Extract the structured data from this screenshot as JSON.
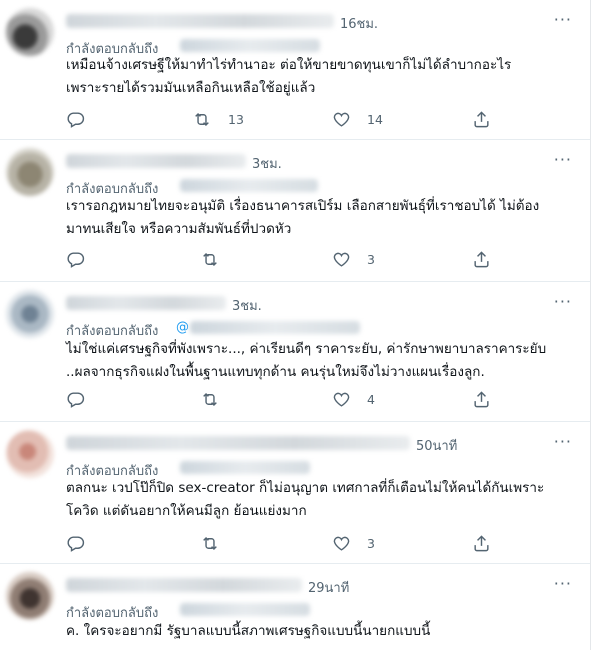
{
  "tweets": [
    {
      "time": "16ชม.",
      "reply_label": "กำลังตอบกลับถึง",
      "lines": [
        "เหมือนจ้างเศรษฐีให้มาทำไร่ทำนาอะ ต่อให้ขายขาดทุนเขาก็ไม่ได้ลำบากอะไร",
        "เพราะรายได้รวมมันเหลือกินเหลือใช้อยู่แล้ว"
      ],
      "retweets": "13",
      "likes": "14"
    },
    {
      "time": "3ชม.",
      "reply_label": "กำลังตอบกลับถึง",
      "lines": [
        "เรารอกฎหมายไทยจะอนุมัติ เรื่องธนาคารสเปิร์ม  เลือกสายพันธุ์ที่เราชอบได้ ไม่ต้อง",
        "มาทนเสียใจ หรือความสัมพันธ์ที่ปวดหัว"
      ],
      "retweets": "",
      "likes": "3"
    },
    {
      "time": "3ชม.",
      "reply_label": "กำลังตอบกลับถึง",
      "reply_at": "@",
      "lines": [
        "ไม่ใช่แค่เศรษฐกิจที่พังเพราะ..., ค่าเรียนดีๆ ราคาระยับ, ค่ารักษาพยาบาลราคาระยับ",
        "..ผลจากธุรกิจแฝงในพื้นฐานแทบทุกด้าน คนรุ่นใหม่จึงไม่วางแผนเรื่องลูก."
      ],
      "retweets": "",
      "likes": "4"
    },
    {
      "time": "50นาที",
      "reply_label": "กำลังตอบกลับถึง",
      "lines": [
        "ตลกนะ เวปโป๊ก็ปิด sex-creator ก็ไม่อนุญาต เทศกาลที่ก็เตือนไม่ให้คนได้กันเพราะ",
        "โควิด แต่ดันอยากให้คนมีลูก ย้อนแย่งมาก"
      ],
      "retweets": "",
      "likes": "3"
    },
    {
      "time": "29นาที",
      "reply_label": "กำลังตอบกลับถึง",
      "lines": [
        "ค. ใครจะอยากมี รัฐบาลแบบนี้สภาพเศรษฐกิจแบบนี้นายกแบบนี้"
      ]
    }
  ],
  "icons": {
    "more": "more-icon",
    "reply": "reply-icon",
    "retweet": "retweet-icon",
    "like": "like-icon",
    "share": "share-icon"
  },
  "colors": {
    "muted": "#536471",
    "link": "#1d9bf0",
    "divider": "#e6ecf0"
  }
}
